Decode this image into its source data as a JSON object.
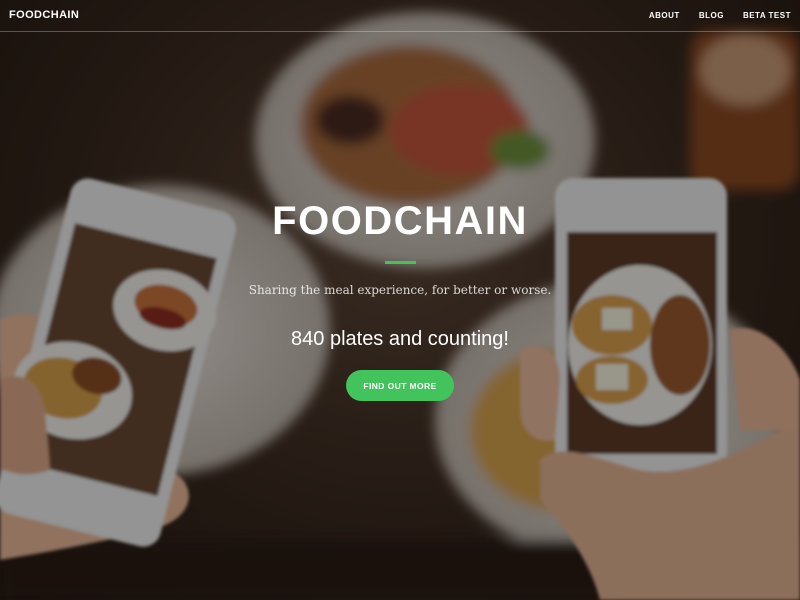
{
  "nav": {
    "brand": "FOODCHAIN",
    "links": [
      "ABOUT",
      "BLOG",
      "BETA TEST"
    ]
  },
  "hero": {
    "title": "FOODCHAIN",
    "tagline": "Sharing the meal experience, for better or worse.",
    "count_text": "840 plates and counting!",
    "cta_label": "FIND OUT MORE"
  },
  "colors": {
    "accent": "#42c35b",
    "text": "#ffffff"
  }
}
